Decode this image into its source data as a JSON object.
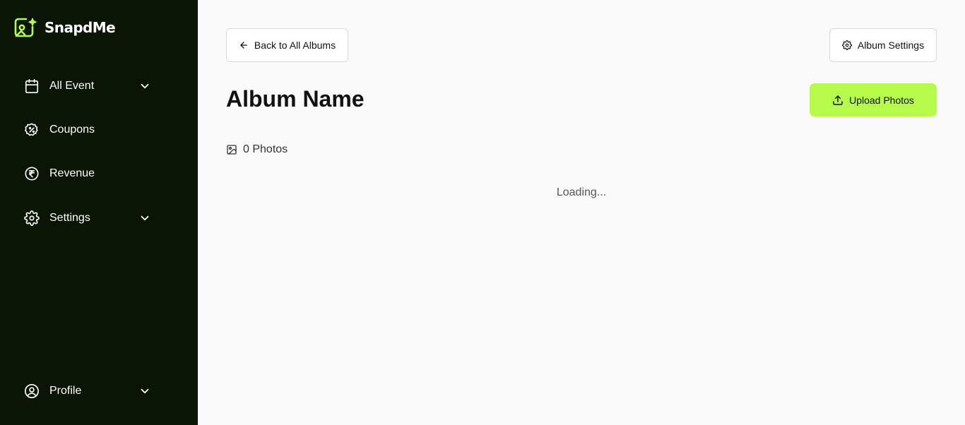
{
  "brand": {
    "name": "SnapdMe",
    "accent_color": "#b6fb4a",
    "sidebar_color": "#0a1505"
  },
  "sidebar": {
    "items": [
      {
        "label": "All Event",
        "icon": "calendar-icon",
        "expandable": true
      },
      {
        "label": "Coupons",
        "icon": "coupon-icon",
        "expandable": false
      },
      {
        "label": "Revenue",
        "icon": "rupee-icon",
        "expandable": false
      },
      {
        "label": "Settings",
        "icon": "gear-icon",
        "expandable": true
      }
    ],
    "profile": {
      "label": "Profile",
      "icon": "user-circle-icon",
      "expandable": true
    }
  },
  "header": {
    "back_label": "Back to All Albums",
    "back_icon": "arrow-left-icon",
    "settings_label": "Album Settings",
    "settings_icon": "gear-icon"
  },
  "album": {
    "title": "Album Name",
    "upload_label": "Upload Photos",
    "upload_icon": "upload-icon",
    "photo_count": "0 Photos",
    "photo_icon": "image-icon"
  },
  "status": {
    "loading": "Loading..."
  }
}
